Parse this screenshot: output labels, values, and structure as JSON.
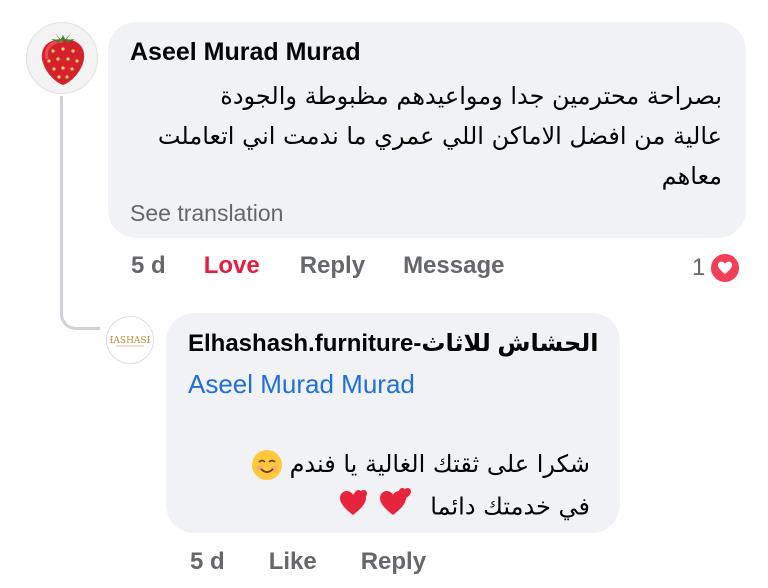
{
  "comment": {
    "author": "Aseel Murad Murad",
    "text_line_1": "بصراحة محترمين جدا ومواعيدهم مظبوطة والجودة",
    "text_line_2": "عالية من افضل الاماكن اللي عمري ما ندمت اني اتعاملت",
    "text_line_3": "معاهم",
    "see_translation": "See translation",
    "time": "5 d",
    "love_label": "Love",
    "reply_label": "Reply",
    "message_label": "Message",
    "reaction_count": "1",
    "avatar_icon": "strawberry-icon",
    "reaction_icon": "heart-icon"
  },
  "reply": {
    "author": "Elhashash.furniture-الحشاش للاثاث",
    "mention": "Aseel Murad Murad",
    "text_line_1": "شكرا على ثقتك الغالية يا فندم",
    "text_line_2": "في خدمتك دائما",
    "time": "5 d",
    "like_label": "Like",
    "reply_label": "Reply",
    "avatar_icon": "brand-logo-icon"
  },
  "colors": {
    "bubble_bg": "#f0f2f5",
    "love": "#e41e3f",
    "mention": "#216fdb",
    "secondary_text": "#65676b",
    "heart_badge": "#f33e58"
  }
}
